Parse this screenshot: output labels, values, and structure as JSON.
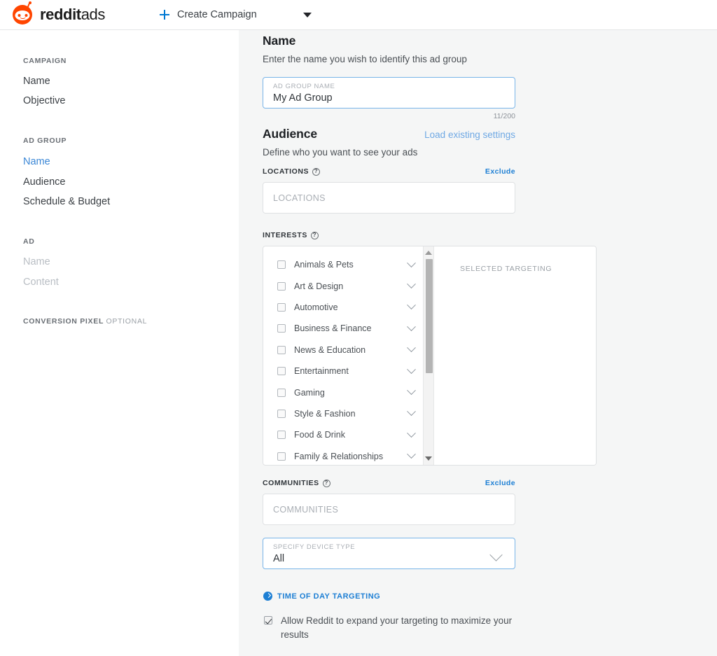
{
  "topbar": {
    "brand_first": "reddit",
    "brand_second": "ads",
    "create_campaign_label": "Create Campaign",
    "plus_icon": "plus-icon",
    "caret_icon": "caret-down-icon",
    "accent_color": "#ff4500",
    "link_color": "#0079d3"
  },
  "sidebar": {
    "groups": [
      {
        "title": "CAMPAIGN",
        "items": [
          {
            "label": "Name",
            "state": "default"
          },
          {
            "label": "Objective",
            "state": "default"
          }
        ]
      },
      {
        "title": "AD GROUP",
        "items": [
          {
            "label": "Name",
            "state": "active"
          },
          {
            "label": "Audience",
            "state": "default"
          },
          {
            "label": "Schedule & Budget",
            "state": "default"
          }
        ]
      },
      {
        "title": "AD",
        "items": [
          {
            "label": "Name",
            "state": "disabled"
          },
          {
            "label": "Content",
            "state": "disabled"
          }
        ]
      }
    ],
    "pixel_title": "CONVERSION PIXEL",
    "pixel_optional": "OPTIONAL",
    "active_color": "#3b87d6"
  },
  "main": {
    "name_section": {
      "heading": "Name",
      "subtitle": "Enter the name you wish to identify this ad group",
      "input_label": "AD GROUP NAME",
      "input_value": "My Ad Group",
      "char_count": "11/200"
    },
    "audience_section": {
      "heading": "Audience",
      "load_settings_link": "Load existing settings",
      "subtitle": "Define who you want to see your ads"
    },
    "locations": {
      "label": "LOCATIONS",
      "help_icon": "help-icon",
      "exclude_label": "Exclude",
      "placeholder": "LOCATIONS"
    },
    "interests": {
      "label": "INTERESTS",
      "help_icon": "help-icon",
      "selected_title": "SELECTED TARGETING",
      "options": [
        "Animals & Pets",
        "Art & Design",
        "Automotive",
        "Business & Finance",
        "News & Education",
        "Entertainment",
        "Gaming",
        "Style & Fashion",
        "Food & Drink",
        "Family & Relationships"
      ]
    },
    "communities": {
      "label": "COMMUNITIES",
      "help_icon": "help-icon",
      "exclude_label": "Exclude",
      "placeholder": "COMMUNITIES"
    },
    "device": {
      "label": "SPECIFY DEVICE TYPE",
      "value": "All",
      "chevron_icon": "chevron-down-icon"
    },
    "time_of_day": {
      "label": "TIME OF DAY TARGETING",
      "icon": "chevron-right-circle-icon"
    },
    "expand_targeting": {
      "label": "Allow Reddit to expand your targeting to maximize your results",
      "checked": true
    }
  }
}
